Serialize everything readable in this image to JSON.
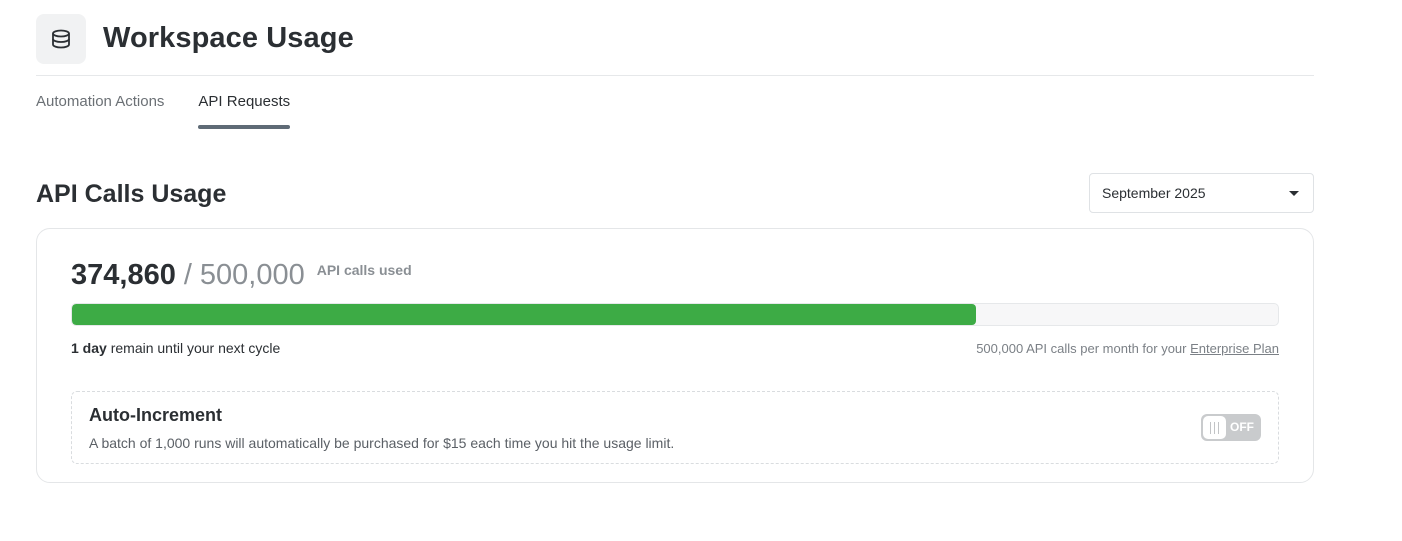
{
  "header": {
    "title": "Workspace Usage",
    "icon": "database-icon"
  },
  "tabs": [
    {
      "label": "Automation Actions",
      "active": false
    },
    {
      "label": "API Requests",
      "active": true
    }
  ],
  "section": {
    "title": "API Calls Usage"
  },
  "month_select": {
    "value": "September 2025"
  },
  "usage": {
    "used": "374,860",
    "separator": "/",
    "total": "500,000",
    "label": "API calls used",
    "progress_fraction": 0.7497,
    "bar_color": "#3dab45"
  },
  "cycle": {
    "days": "1 day",
    "text": " remain until your next cycle"
  },
  "plan": {
    "text": "500,000 API calls per month for your ",
    "link": "Enterprise Plan"
  },
  "auto_increment": {
    "title": "Auto-Increment",
    "description": "A batch of 1,000 runs will automatically be purchased for $15 each time you hit the usage limit.",
    "toggle_state": "OFF"
  }
}
